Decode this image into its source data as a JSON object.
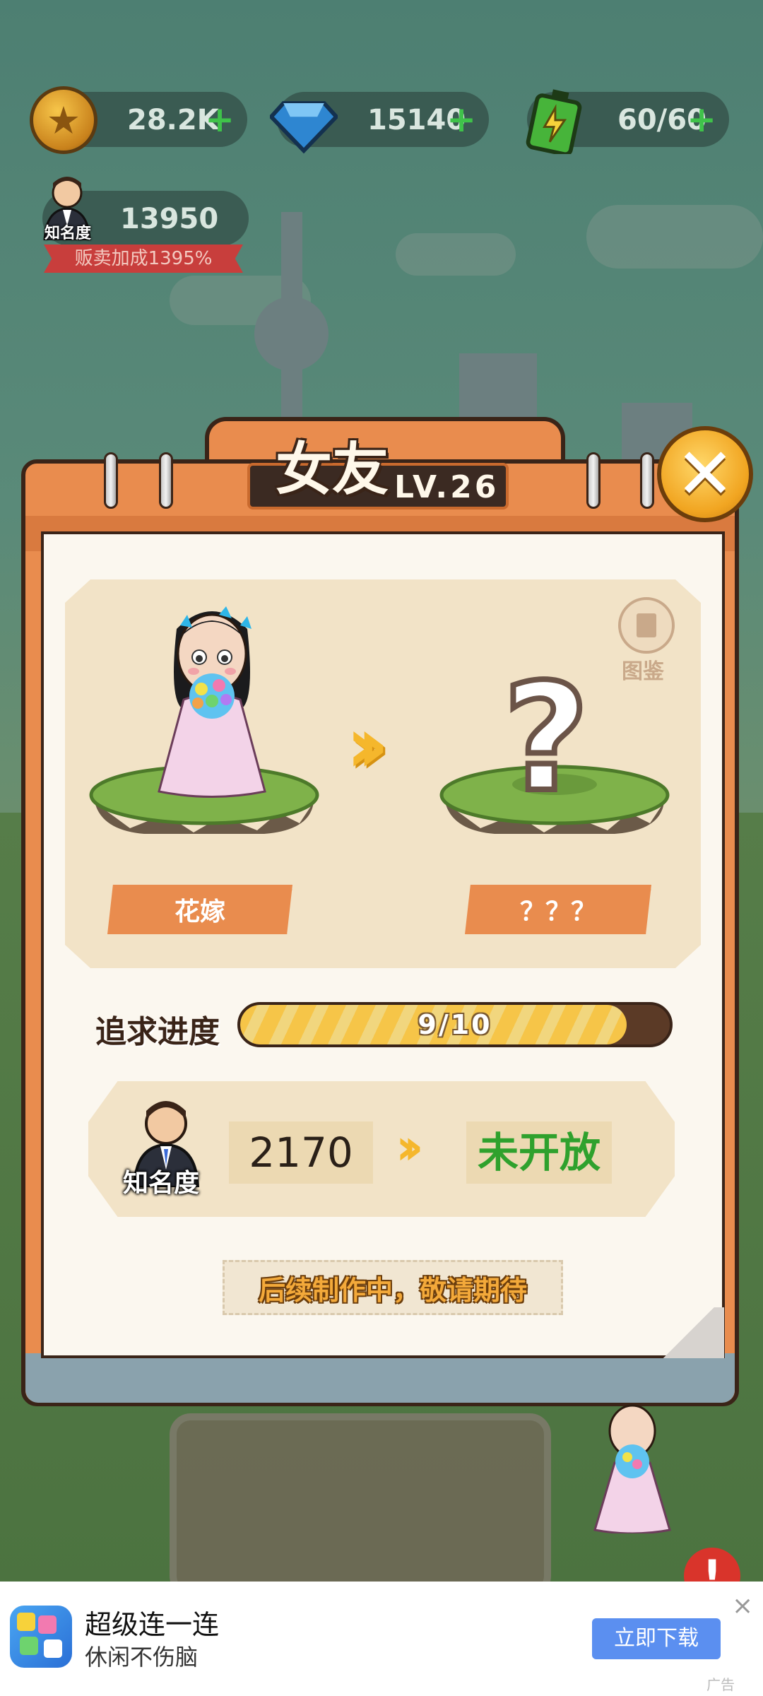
{
  "hud": {
    "coins": "28.2K",
    "gems": "15140",
    "energy": "60/60",
    "plus": "+",
    "fame_value": "13950",
    "fame_label": "知名度",
    "sell_bonus": "贩卖加成1395%"
  },
  "modal": {
    "title": "女友",
    "level": "LV.26",
    "close_glyph": "✕",
    "atlas_label": "图鉴",
    "current_name": "花嫁",
    "next_name": "？？？",
    "unknown_glyph": "?",
    "progress_label": "追求进度",
    "progress_text": "9/10",
    "progress_value": 0.9,
    "fame_label": "知名度",
    "fame_required": "2170",
    "fame_next": "未开放",
    "coming_soon": "后续制作中，敬请期待"
  },
  "ad": {
    "title": "超级连一连",
    "subtitle": "休闲不伤脑",
    "button": "立即下载",
    "close": "×",
    "mark": "广告"
  },
  "colors": {
    "accent": "#e98c4e",
    "progress": "#f6c548",
    "closed_green": "#2fa12d",
    "ad_button": "#5b8ff0"
  },
  "icons": [
    "coin-icon",
    "gem-icon",
    "battery-icon",
    "fame-avatar-icon",
    "close-icon",
    "atlas-icon",
    "double-arrow-icon"
  ]
}
